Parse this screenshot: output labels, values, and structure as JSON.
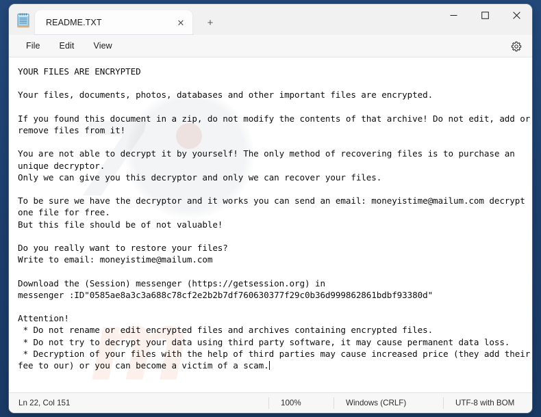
{
  "window": {
    "app_icon": "notepad-icon",
    "controls": {
      "minimize": "minimize-icon",
      "maximize": "maximize-icon",
      "close": "close-icon"
    }
  },
  "tabs": [
    {
      "title": "README.TXT",
      "close_label": "✕",
      "active": true
    }
  ],
  "new_tab_label": "+",
  "menu": {
    "items": [
      {
        "label": "File"
      },
      {
        "label": "Edit"
      },
      {
        "label": "View"
      }
    ],
    "settings_icon": "gear-icon"
  },
  "document": {
    "filename": "README.TXT",
    "content": "YOUR FILES ARE ENCRYPTED\n\nYour files, documents, photos, databases and other important files are encrypted.\n\nIf you found this document in a zip, do not modify the contents of that archive! Do not edit, add or remove files from it!\n\nYou are not able to decrypt it by yourself! The only method of recovering files is to purchase an unique decryptor.\nOnly we can give you this decryptor and only we can recover your files.\n\nTo be sure we have the decryptor and it works you can send an email: moneyistime@mailum.com decrypt one file for free.\nBut this file should be of not valuable!\n\nDo you really want to restore your files?\nWrite to email: moneyistime@mailum.com\n\nDownload the (Session) messenger (https://getsession.org) in\nmessenger :ID\"0585ae8a3c3a688c78cf2e2b2b7df760630377f29c0b36d999862861bdbf93380d\"\n\nAttention!\n * Do not rename or edit encrypted files and archives containing encrypted files.\n * Do not try to decrypt your data using third party software, it may cause permanent data loss.\n * Decryption of your files with the help of third parties may cause increased price (they add their fee to our) or you can become a victim of a scam.",
    "contact_email": "moneyistime@mailum.com",
    "session_url": "https://getsession.org",
    "session_id": "0585ae8a3c3a688c78cf2e2b2b7df760630377f29c0b36d999862861bdbf93380d"
  },
  "watermarks": {
    "grey_text": "7",
    "orange_text": "m"
  },
  "statusbar": {
    "cursor_position": "Ln 22, Col 151",
    "zoom": "100%",
    "line_ending": "Windows (CRLF)",
    "encoding": "UTF-8 with BOM"
  },
  "colors": {
    "desktop": "#1f4576",
    "window_bg": "#f7f7f7",
    "editor_bg": "#ffffff",
    "text": "#0d0d0d",
    "close_hover": "#e81123"
  }
}
